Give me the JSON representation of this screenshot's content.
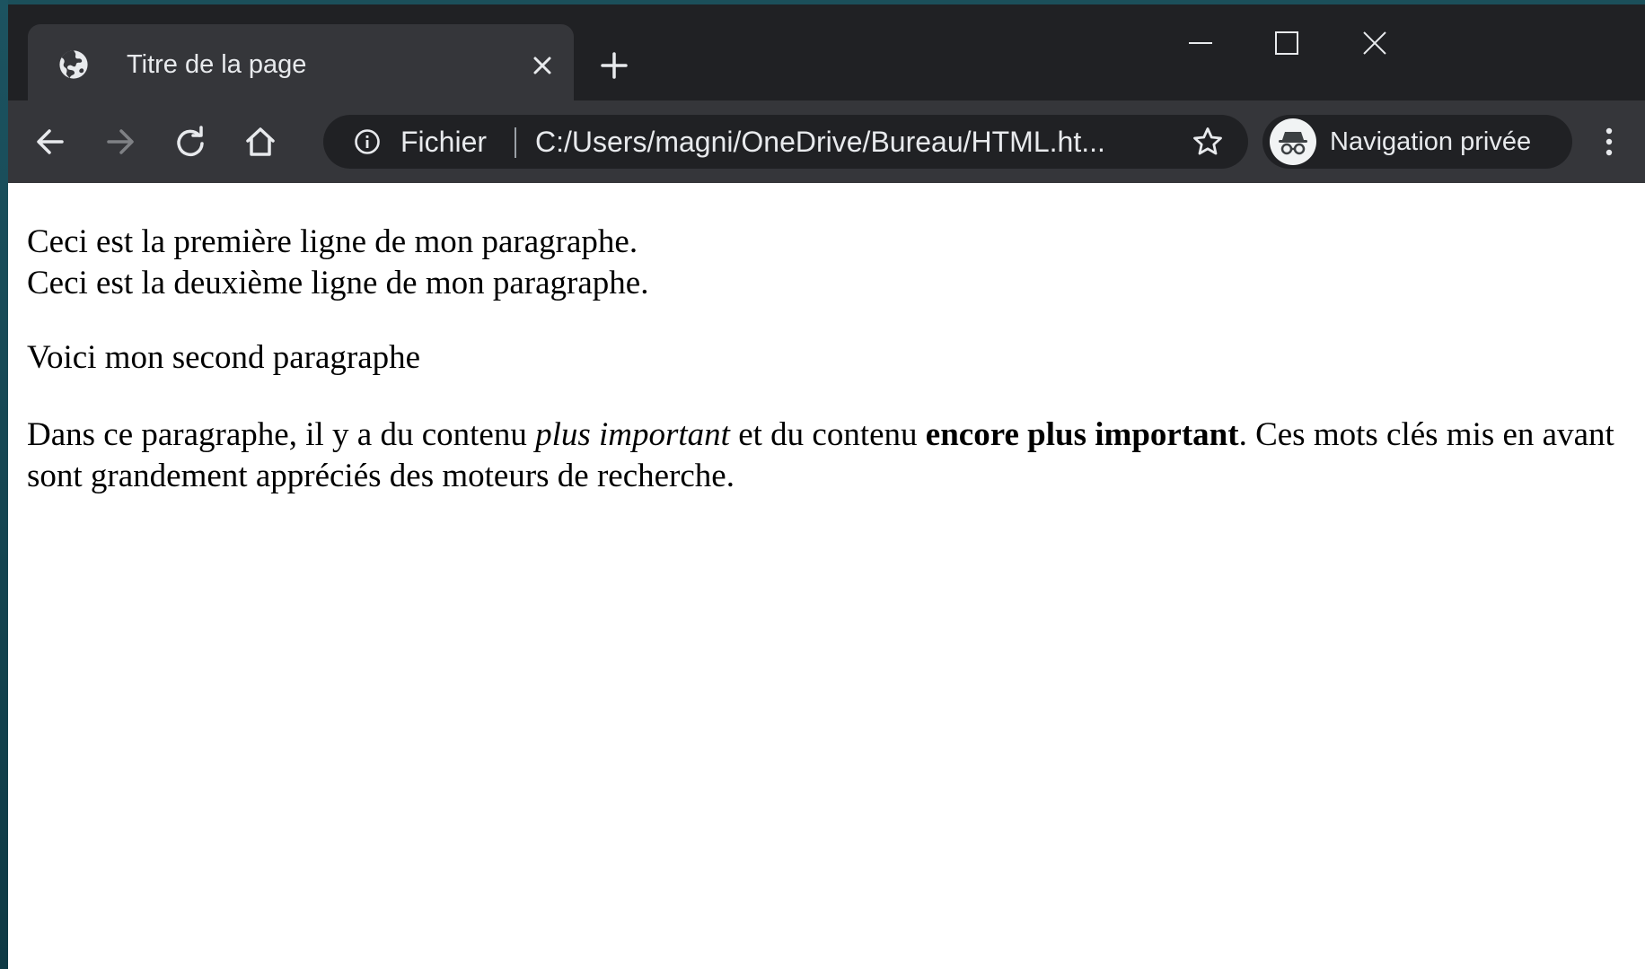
{
  "browser": {
    "tab": {
      "title": "Titre de la page"
    },
    "omnibox": {
      "scheme_label": "Fichier",
      "url": "C:/Users/magni/OneDrive/Bureau/HTML.ht..."
    },
    "profile": {
      "label": "Navigation privée"
    },
    "icons": {
      "tab": "globe-icon",
      "close_tab": "close-icon",
      "new_tab": "plus-icon",
      "back": "arrow-left-icon",
      "forward": "arrow-right-icon",
      "reload": "reload-icon",
      "home": "home-icon",
      "site_info": "info-icon",
      "bookmark": "star-icon",
      "incognito": "incognito-icon",
      "menu": "kebab-menu-icon",
      "minimize": "minimize-icon",
      "maximize": "maximize-icon",
      "close_window": "close-icon"
    },
    "colors": {
      "titlebar": "#202124",
      "toolbar": "#35363a",
      "omnibox": "#202124",
      "text": "#e8eaed"
    }
  },
  "page": {
    "paragraph1": {
      "line1": "Ceci est la première ligne de mon paragraphe.",
      "line2": "Ceci est la deuxième ligne de mon paragraphe."
    },
    "paragraph2": "Voici mon second paragraphe",
    "paragraph3": {
      "before_em": "Dans ce paragraphe, il y a du contenu ",
      "em": "plus important",
      "middle": " et du contenu ",
      "strong": "encore plus important",
      "after": ". Ces mots clés mis en avant sont grandement appréciés des moteurs de recherche."
    }
  }
}
